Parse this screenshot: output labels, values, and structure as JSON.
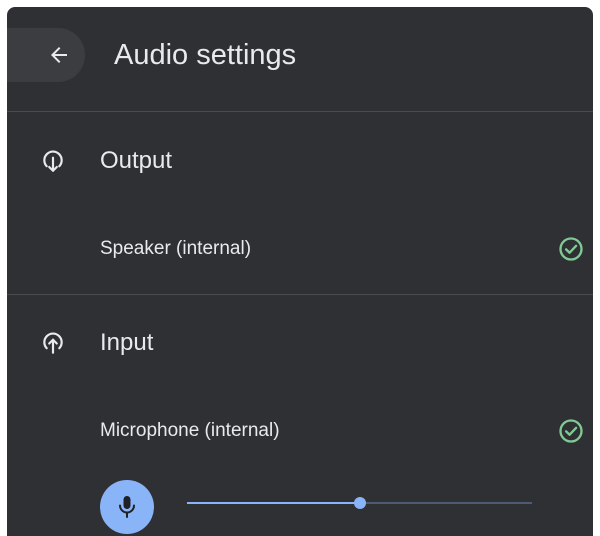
{
  "header": {
    "back_icon": "arrow-back-icon",
    "title": "Audio settings"
  },
  "output": {
    "icon": "output-arrow-down-icon",
    "title": "Output",
    "devices": [
      {
        "label": "Speaker (internal)",
        "selected": true,
        "status_icon": "check-circle-icon"
      }
    ]
  },
  "input": {
    "icon": "input-arrow-up-icon",
    "title": "Input",
    "devices": [
      {
        "label": "Microphone (internal)",
        "selected": true,
        "status_icon": "check-circle-icon"
      }
    ],
    "mic_icon": "microphone-icon",
    "gain_percent": 50
  },
  "colors": {
    "panel_background": "#2f3034",
    "text": "#e8eaed",
    "accent": "#8ab4f8",
    "check": "#81c995",
    "divider": "#4a4b4f"
  }
}
